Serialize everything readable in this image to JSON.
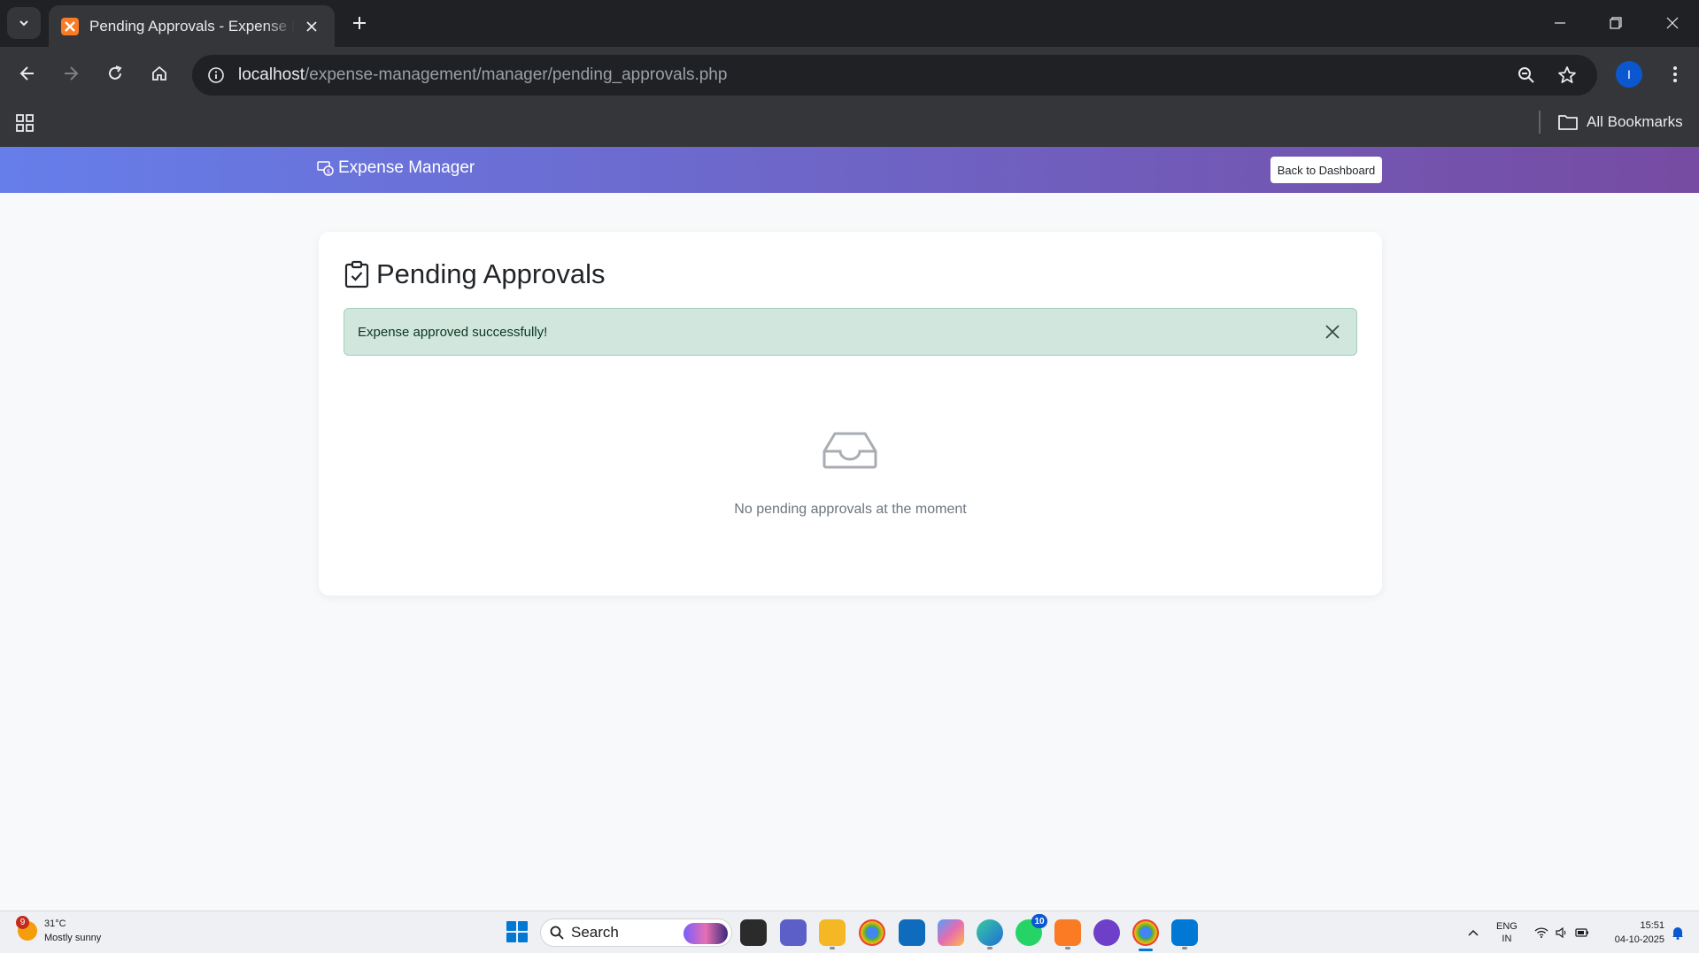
{
  "browser": {
    "tab_title": "Pending Approvals - Expense Management",
    "url_host": "localhost",
    "url_path": "/expense-management/manager/pending_approvals.php",
    "bookmarks_label": "All Bookmarks",
    "profile_initial": "I"
  },
  "app": {
    "brand": "Expense Manager",
    "back_button": "Back to Dashboard",
    "page_title": "Pending Approvals",
    "alert_message": "Expense approved successfully!",
    "empty_message": "No pending approvals at the moment",
    "colors": {
      "nav_gradient_start": "#667eea",
      "nav_gradient_end": "#764ba2",
      "alert_bg": "#d1e7dd",
      "alert_text": "#0a3622"
    }
  },
  "taskbar": {
    "weather_temp": "31°C",
    "weather_desc": "Mostly sunny",
    "weather_badge": "9",
    "search_placeholder": "Search",
    "whatsapp_badge": "10",
    "language_top": "ENG",
    "language_bottom": "IN",
    "time": "15:51",
    "date": "04-10-2025",
    "apps": [
      "file-explorer-icon",
      "teams-icon",
      "folder-icon",
      "chrome-icon",
      "outlook-icon",
      "copilot-icon",
      "edge-icon",
      "whatsapp-icon",
      "xampp-icon",
      "github-icon",
      "chrome-profile-icon",
      "vscode-icon"
    ]
  }
}
